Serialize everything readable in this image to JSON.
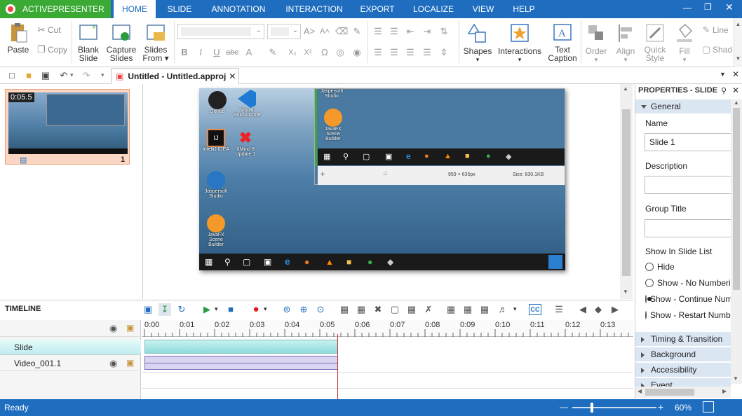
{
  "app": {
    "brand": "ACTIVEPRESENTER"
  },
  "tabs": [
    "HOME",
    "SLIDE",
    "ANNOTATION",
    "INTERACTION",
    "EXPORT",
    "LOCALIZE",
    "VIEW",
    "HELP"
  ],
  "ribbon": {
    "paste": "Paste",
    "cut": "Cut",
    "copy": "Copy",
    "blank_slide": [
      "Blank",
      "Slide"
    ],
    "capture_slides": [
      "Capture",
      "Slides"
    ],
    "slides_from": [
      "Slides",
      "From"
    ],
    "shapes": "Shapes",
    "interactions": "Interactions",
    "text_caption": [
      "Text",
      "Caption"
    ],
    "order": "Order",
    "align": "Align",
    "quick_style": [
      "Quick",
      "Style"
    ],
    "fill": "Fill",
    "line": "Line",
    "shadow": "Shad"
  },
  "document": {
    "tab_title": "Untitled - Untitled.approj"
  },
  "thumbnail": {
    "duration": "0:05.5",
    "number": "1"
  },
  "canvas": {
    "icons": [
      "GitHub",
      "Visual Studio Code",
      "IntelliJ IDEA",
      "XMind 8 Update 1",
      "Jaspersoft Studio",
      "JavaFX Scene Builder"
    ],
    "inner_icons": [
      "Jaspersoft Studio",
      "JavaFX Scene Builder"
    ],
    "inner_status": {
      "size_px": "959 × 635px",
      "size_kb": "Size: 830.1KB"
    }
  },
  "timeline": {
    "title": "TIMELINE",
    "ticks": [
      "0:00",
      "0:01",
      "0:02",
      "0:03",
      "0:04",
      "0:05",
      "0:06",
      "0:07",
      "0:08",
      "0:09",
      "0:10",
      "0:11",
      "0:12",
      "0:13"
    ],
    "tracks": [
      "Slide",
      "Video_001.1"
    ],
    "cc_label": "CC"
  },
  "properties": {
    "title": "PROPERTIES - SLIDE",
    "general": "General",
    "name_label": "Name",
    "name_value": "Slide 1",
    "description_label": "Description",
    "description_value": "",
    "group_title_label": "Group Title",
    "group_title_value": "",
    "show_in_list_label": "Show In Slide List",
    "options": [
      "Hide",
      "Show - No Numbering",
      "Show - Continue Numbering",
      "Show - Restart Numbering"
    ],
    "selected_option": 2,
    "sections": [
      "Timing & Transition",
      "Background",
      "Accessibility",
      "Event"
    ]
  },
  "status": {
    "text": "Ready",
    "zoom": "60%",
    "zoom_fraction": 0.22
  },
  "colors": {
    "accent": "#1e6dbf",
    "brand": "#3aaa35",
    "record": "#e51c23",
    "play": "#2e9a3e"
  }
}
